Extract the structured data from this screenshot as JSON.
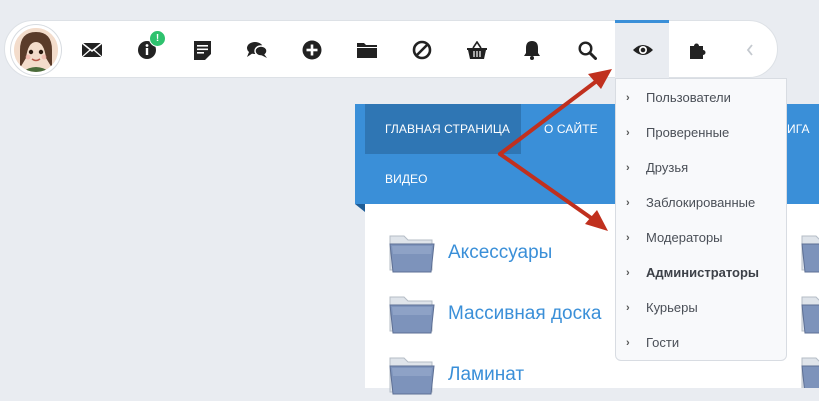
{
  "toolbar": {
    "icons": [
      {
        "name": "mail-icon"
      },
      {
        "name": "info-icon",
        "badge": "!"
      },
      {
        "name": "notes-icon"
      },
      {
        "name": "chat-icon"
      },
      {
        "name": "add-icon"
      },
      {
        "name": "folder-icon"
      },
      {
        "name": "block-icon"
      },
      {
        "name": "basket-icon"
      },
      {
        "name": "bell-icon"
      },
      {
        "name": "search-icon"
      },
      {
        "name": "eye-icon",
        "active": true
      },
      {
        "name": "puzzle-icon"
      },
      {
        "name": "chevron-left-icon"
      }
    ],
    "accent_color": "#3a8fd8",
    "badge_color": "#2ec26e"
  },
  "navbar": {
    "items": [
      "ГЛАВНАЯ СТРАНИЦА",
      "О САЙТЕ",
      "ИГА",
      "ВИДЕО"
    ],
    "active": "ГЛАВНАЯ СТРАНИЦА"
  },
  "categories": [
    "Аксессуары",
    "Массивная доска",
    "Ламинат"
  ],
  "dropdown": {
    "items": [
      {
        "label": "Пользователи",
        "bold": false
      },
      {
        "label": "Проверенные",
        "bold": false
      },
      {
        "label": "Друзья",
        "bold": false
      },
      {
        "label": "Заблокированные",
        "bold": false
      },
      {
        "label": "Модераторы",
        "bold": false
      },
      {
        "label": "Администраторы",
        "bold": true
      },
      {
        "label": "Курьеры",
        "bold": false
      },
      {
        "label": "Гости",
        "bold": false
      }
    ]
  },
  "annotation_color": "#c0301e"
}
